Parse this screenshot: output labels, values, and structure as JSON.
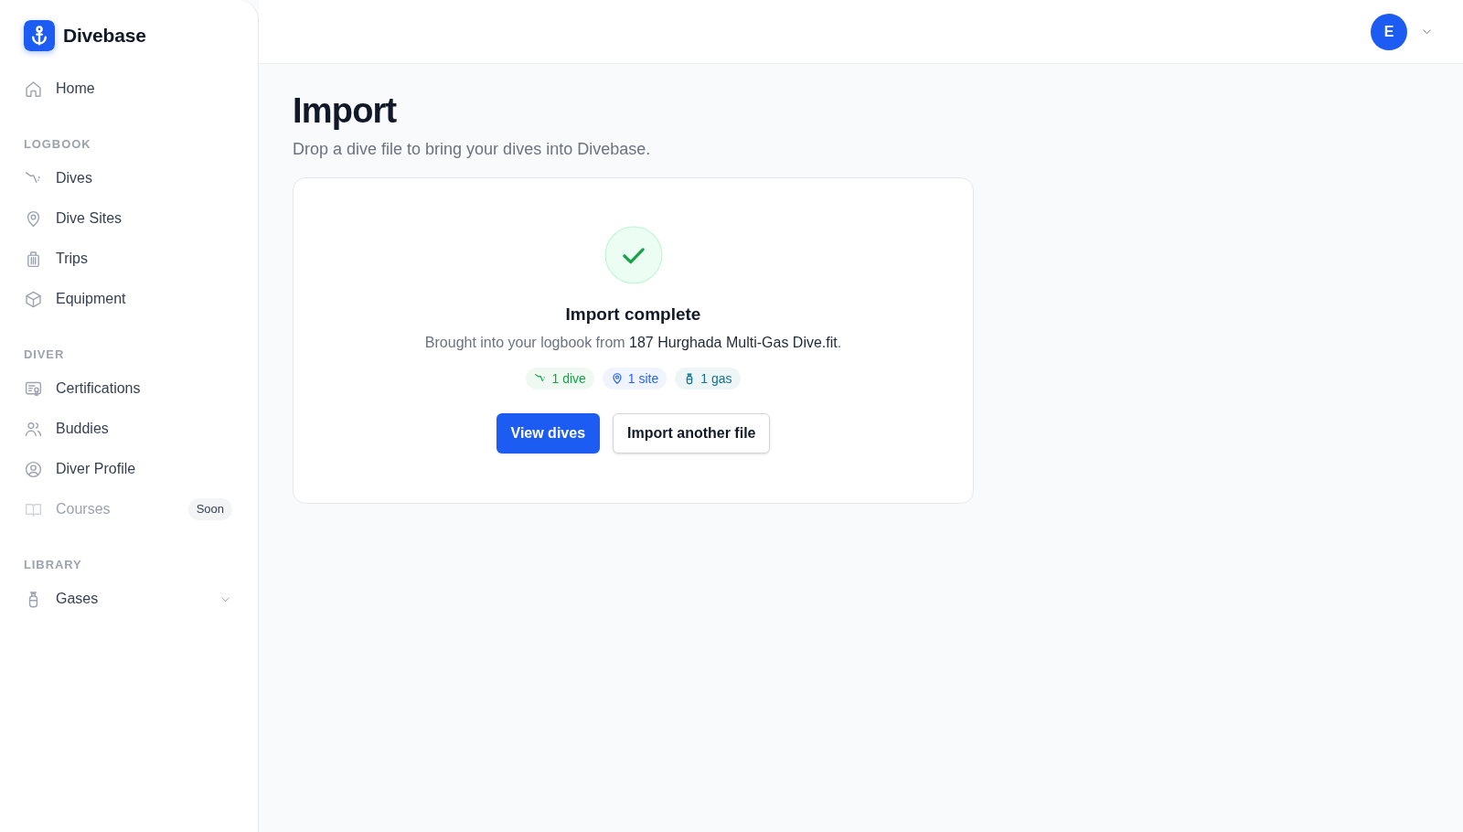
{
  "app": {
    "name": "Divebase"
  },
  "sidebar": {
    "sections": [
      {
        "items": [
          {
            "label": "Home",
            "selected": false,
            "disabled": false
          }
        ]
      },
      {
        "heading": "LOGBOOK",
        "items": [
          {
            "label": "Dives",
            "selected": false,
            "disabled": false
          },
          {
            "label": "Dive Sites",
            "selected": false,
            "disabled": false
          },
          {
            "label": "Trips",
            "selected": false,
            "disabled": false
          },
          {
            "label": "Equipment",
            "selected": false,
            "disabled": false
          }
        ]
      },
      {
        "heading": "DIVER",
        "items": [
          {
            "label": "Certifications",
            "selected": false,
            "disabled": false
          },
          {
            "label": "Buddies",
            "selected": false,
            "disabled": false
          },
          {
            "label": "Diver Profile",
            "selected": false,
            "disabled": false
          },
          {
            "label": "Courses",
            "selected": false,
            "disabled": true,
            "badge": "Soon"
          }
        ]
      },
      {
        "heading": "LIBRARY",
        "items": [
          {
            "label": "Gases",
            "selected": false,
            "disabled": false,
            "expanded": false
          }
        ]
      }
    ]
  },
  "topbar": {
    "avatar": "E"
  },
  "page": {
    "title": "Import",
    "subtitle": "Drop a dive file to bring your dives into Divebase."
  },
  "card": {
    "title": "Import complete",
    "message": "Brought into your logbook from **187 Hurghada Multi-Gas Dive.fit**.",
    "chips": [
      {
        "label": "1 dive",
        "color": "#16a34a"
      },
      {
        "label": "1 site",
        "color": "#2563eb"
      },
      {
        "label": "1 gas",
        "color": "#0e7490"
      }
    ],
    "buttons": [
      {
        "label": "View dives",
        "kind": "primary"
      },
      {
        "label": "Import another file",
        "kind": "secondary"
      }
    ]
  }
}
